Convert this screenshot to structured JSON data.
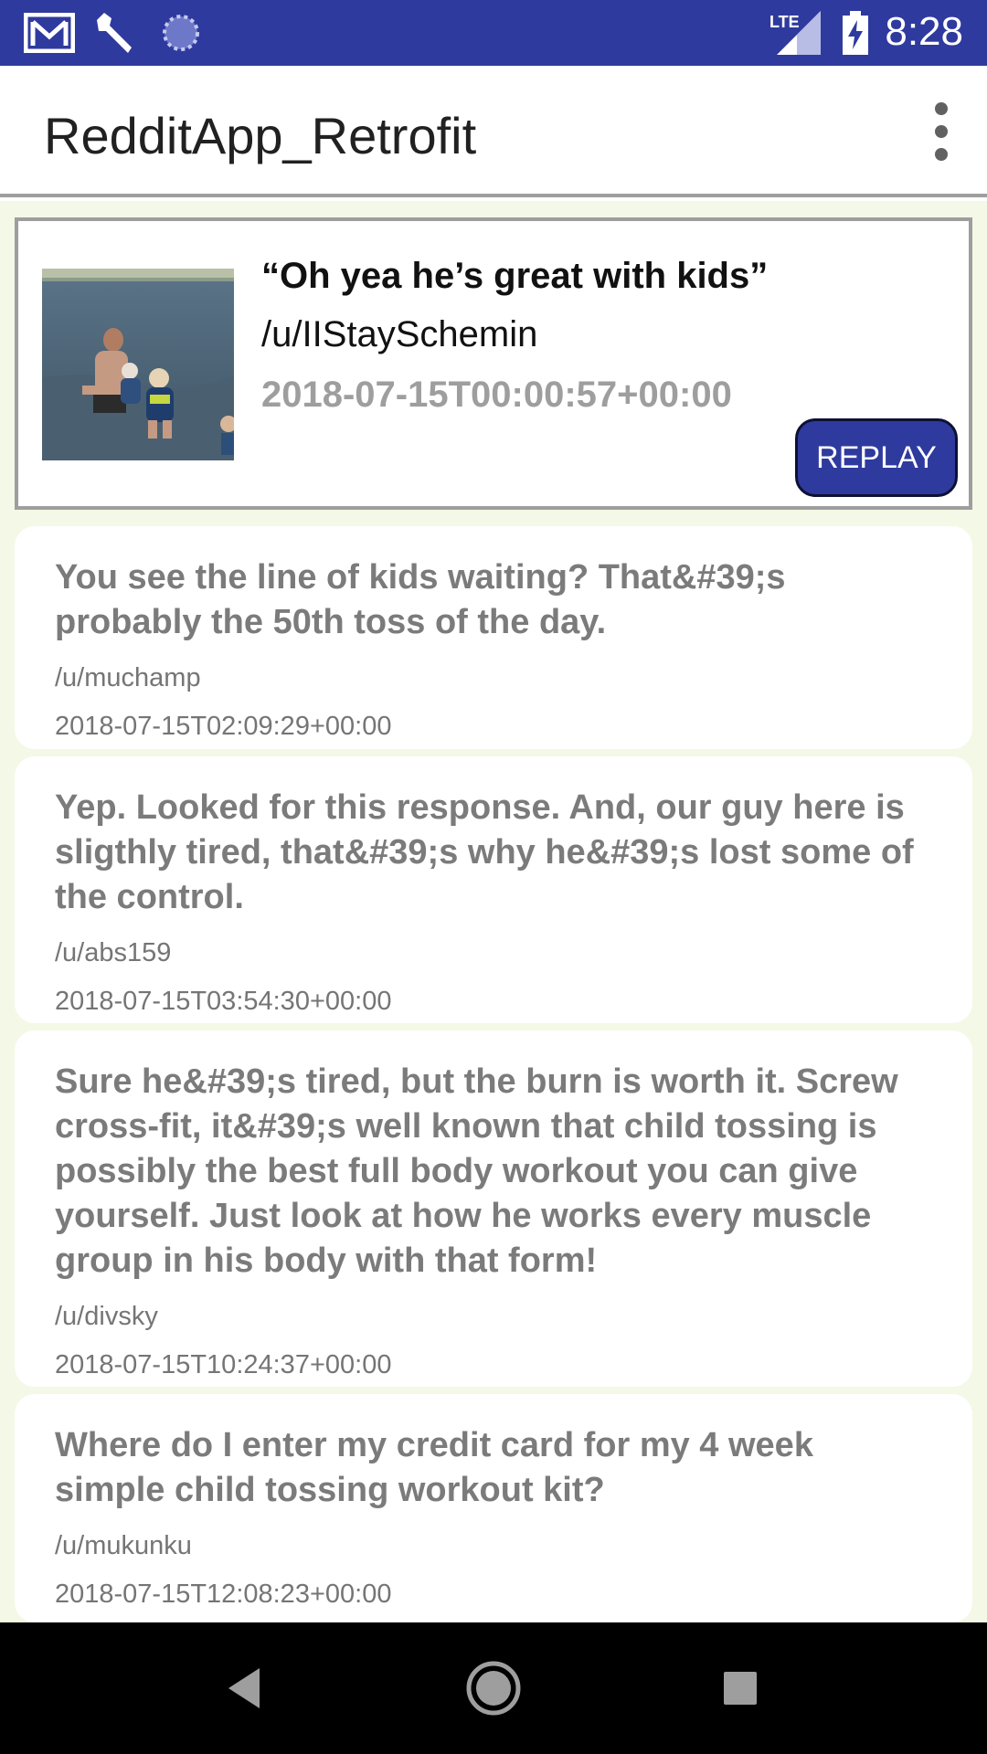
{
  "status_bar": {
    "time": "8:28",
    "network": "LTE",
    "icons": [
      "gmail-icon",
      "wrench-icon",
      "sync-icon",
      "lte-signal-icon",
      "battery-charging-icon"
    ]
  },
  "app_bar": {
    "title": "RedditApp_Retrofit",
    "menu_icon": "more-vert-icon"
  },
  "post": {
    "title": "“Oh yea he’s great with kids”",
    "author": "/u/IIStaySchemin",
    "date": "2018-07-15T00:00:57+00:00",
    "replay_label": "REPLAY"
  },
  "comments": [
    {
      "body": "You see the line of kids waiting? That&#39;s probably the 50th toss of the day.",
      "author": "/u/muchamp",
      "date": "2018-07-15T02:09:29+00:00"
    },
    {
      "body": "Yep. Looked for this response. And, our guy here is sligthly tired, that&#39;s why he&#39;s lost some of the control.",
      "author": "/u/abs159",
      "date": "2018-07-15T03:54:30+00:00"
    },
    {
      "body": "Sure he&#39;s tired, but the burn is worth it. Screw cross-fit, it&#39;s well known that child tossing is possibly the best full body workout you can give yourself. Just look at how he works every muscle group in his body with that form!",
      "author": "/u/divsky",
      "date": "2018-07-15T10:24:37+00:00"
    },
    {
      "body": "Where do I enter my credit card for my 4 week simple child tossing workout kit?",
      "author": "/u/mukunku",
      "date": "2018-07-15T12:08:23+00:00"
    }
  ],
  "nav_bar": {
    "icons": [
      "back-icon",
      "home-icon",
      "recents-icon"
    ]
  },
  "colors": {
    "primary": "#2f3a9e",
    "card_border": "#9e9e9e",
    "comment_text": "#7b7b7b"
  }
}
